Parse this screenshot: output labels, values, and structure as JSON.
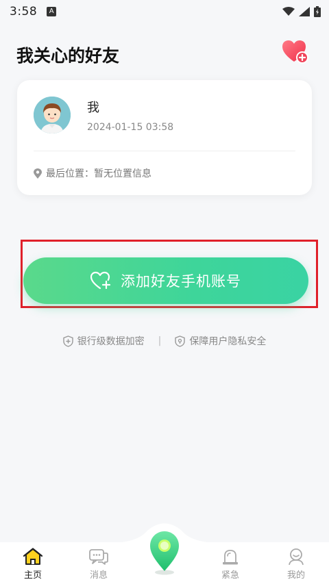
{
  "status_bar": {
    "time": "3:58",
    "notif_letter": "A"
  },
  "header": {
    "title": "我关心的好友"
  },
  "friend_card": {
    "name": "我",
    "time": "2024-01-15 03:58",
    "location_label": "最后位置：暂无位置信息"
  },
  "add_button": {
    "label": "添加好友手机账号"
  },
  "security": {
    "item1": "银行级数据加密",
    "separator": "|",
    "item2": "保障用户隐私安全"
  },
  "nav": {
    "items": [
      {
        "label": "主页",
        "icon": "home-icon",
        "active": true
      },
      {
        "label": "消息",
        "icon": "message-icon",
        "active": false
      },
      {
        "label": "紧急",
        "icon": "alarm-icon",
        "active": false
      },
      {
        "label": "我的",
        "icon": "profile-icon",
        "active": false
      }
    ]
  },
  "colors": {
    "accent": "#3ed59a",
    "highlight": "#e0202a",
    "heart": "#f0445a"
  }
}
